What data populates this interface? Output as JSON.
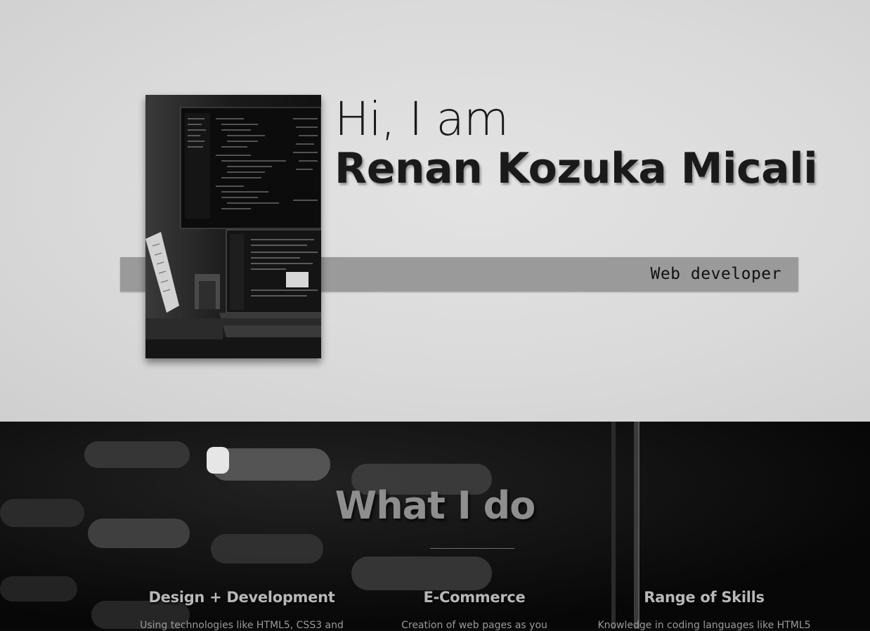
{
  "hero": {
    "greeting": "Hi, I am",
    "name": "Renan Kozuka Micali",
    "role": "Web developer"
  },
  "what_i_do": {
    "title": "What I do",
    "columns": [
      {
        "title": "Design + Development",
        "text": "Using technologies like HTML5, CSS3 and"
      },
      {
        "title": "E-Commerce",
        "text": "Creation of web pages as you"
      },
      {
        "title": "Range of Skills",
        "text": "Knowledge in coding languages like HTML5"
      }
    ]
  }
}
